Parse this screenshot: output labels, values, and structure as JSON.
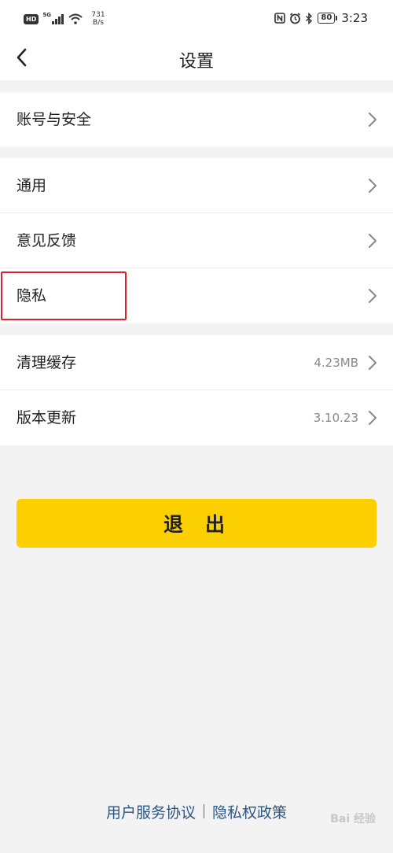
{
  "status_bar": {
    "hd_label": "HD",
    "network_label": "5G",
    "speed_value": "731",
    "speed_unit": "B/s",
    "battery_level": "80",
    "time": "3:23",
    "icons": [
      "signal-icon",
      "wifi-icon",
      "nfc-icon",
      "alarm-icon",
      "bluetooth-icon",
      "battery-icon"
    ]
  },
  "header": {
    "title": "设置",
    "back_icon": "back-arrow-icon"
  },
  "settings": {
    "group1": [
      {
        "label": "账号与安全",
        "value": ""
      }
    ],
    "group2": [
      {
        "label": "通用",
        "value": ""
      },
      {
        "label": "意见反馈",
        "value": ""
      },
      {
        "label": "隐私",
        "value": ""
      }
    ],
    "group3": [
      {
        "label": "清理缓存",
        "value": "4.23MB"
      },
      {
        "label": "版本更新",
        "value": "3.10.23"
      }
    ]
  },
  "logout": {
    "label": "退出"
  },
  "footer": {
    "terms_label": "用户服务协议",
    "privacy_label": "隐私权政策"
  },
  "watermark": {
    "text": "Bai 经验"
  },
  "colors": {
    "accent": "#fcd000",
    "background": "#f3f3f3",
    "link": "#2a5585",
    "highlight": "#d9242b"
  }
}
